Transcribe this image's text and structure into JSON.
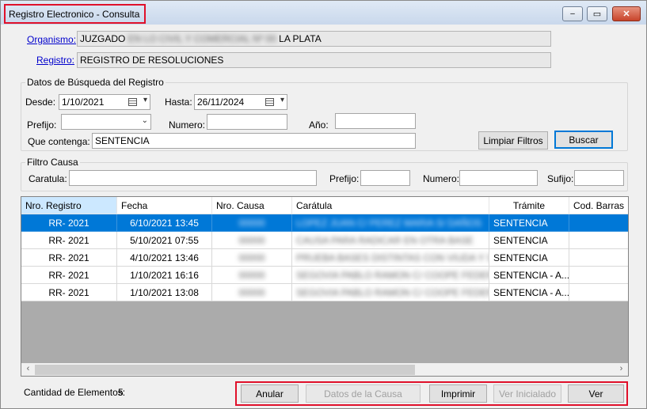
{
  "window": {
    "title": "Registro Electronico - Consulta",
    "controls": {
      "minimize": "–",
      "maximize": "▭",
      "close": "✕"
    }
  },
  "header": {
    "organismo_label": "Organismo:",
    "organismo_prefix": "JUZGADO",
    "organismo_hidden": "EN LO CIVIL Y COMERCIAL Nº 00",
    "organismo_suffix": "LA PLATA",
    "registro_label": "Registro:",
    "registro_value": "REGISTRO DE RESOLUCIONES"
  },
  "search": {
    "legend": "Datos de Búsqueda del Registro",
    "desde_label": "Desde:",
    "desde_value": "1/10/2021",
    "hasta_label": "Hasta:",
    "hasta_value": "26/11/2024",
    "prefijo_label": "Prefijo:",
    "prefijo_value": "",
    "numero_label": "Numero:",
    "numero_value": "",
    "anio_label": "Año:",
    "anio_value": "",
    "contenga_label": "Que contenga:",
    "contenga_value": "SENTENCIA",
    "limpiar_label": "Limpiar Filtros",
    "buscar_label": "Buscar"
  },
  "filtro": {
    "legend": "Filtro Causa",
    "caratula_label": "Caratula:",
    "caratula_value": "",
    "prefijo_label": "Prefijo:",
    "prefijo_value": "",
    "numero_label": "Numero:",
    "numero_value": "",
    "sufijo_label": "Sufijo:",
    "sufijo_value": ""
  },
  "table": {
    "columns": [
      "Nro. Registro",
      "Fecha",
      "Nro. Causa",
      "Carátula",
      "Trámite",
      "Cod. Barras"
    ],
    "rows": [
      {
        "registro": "RR-   2021",
        "fecha": "6/10/2021 13:45",
        "causa": "00000",
        "caratula": "LOPEZ JUAN C/ PEREZ MARIA S/ DAÑOS",
        "tramite": "SENTENCIA",
        "cod": ""
      },
      {
        "registro": "RR-   2021",
        "fecha": "5/10/2021 07:55",
        "causa": "00000",
        "caratula": "CAUSA PARA RADICAR EN OTRA BASE",
        "tramite": "SENTENCIA",
        "cod": ""
      },
      {
        "registro": "RR-   2021",
        "fecha": "4/10/2021 13:46",
        "causa": "00000",
        "caratula": "PRUEBA BASES DISTINTAS CON VIUDA Y SA",
        "tramite": "SENTENCIA",
        "cod": ""
      },
      {
        "registro": "RR-   2021",
        "fecha": "1/10/2021 16:16",
        "causa": "00000",
        "caratula": "SEGOVIA PABLO RAMON C/ COOPE FEDER",
        "tramite": "SENTENCIA - A...",
        "cod": ""
      },
      {
        "registro": "RR-   2021",
        "fecha": "1/10/2021 13:08",
        "causa": "00000",
        "caratula": "SEGOVIA PABLO RAMON C/ COOPE FEDER",
        "tramite": "SENTENCIA - A...",
        "cod": ""
      }
    ]
  },
  "footer": {
    "cantidad_label": "Cantidad de Elementos:",
    "cantidad_value": "5",
    "anular_label": "Anular",
    "datos_causa_label": "Datos de la Causa",
    "imprimir_label": "Imprimir",
    "ver_inicialado_label": "Ver Inicialado",
    "ver_label": "Ver"
  },
  "colors": {
    "selection": "#0078d7",
    "highlight_box": "#e0102a",
    "link": "#0000cc"
  }
}
